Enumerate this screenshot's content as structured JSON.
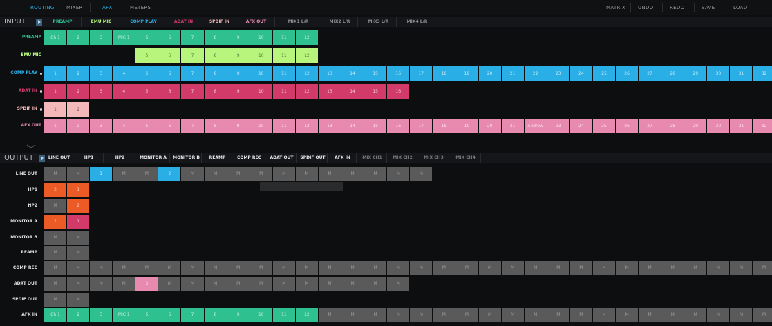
{
  "topnav": {
    "tabs": [
      {
        "label": "ROUTING",
        "active": true
      },
      {
        "label": "MIXER",
        "active": false
      },
      {
        "label": "AFX",
        "active": true
      },
      {
        "label": "METERS",
        "active": false
      }
    ],
    "actions": [
      "MATRIX",
      "UNDO",
      "REDO",
      "SAVE",
      "LOAD"
    ]
  },
  "input": {
    "label": "INPUT",
    "tabs": [
      {
        "label": "PREAMP",
        "color": "#2fc08f"
      },
      {
        "label": "EMU MIC",
        "color": "#b8f57c"
      },
      {
        "label": "COMP PLAY",
        "color": "#2aaee6"
      },
      {
        "label": "ADAT IN",
        "color": "#d23a6a"
      },
      {
        "label": "SPDIF IN",
        "color": "#f3b9ba"
      },
      {
        "label": "AFX OUT",
        "color": "#e889b0"
      },
      {
        "label": "MIX1 L/R",
        "color": "#8c8c8c"
      },
      {
        "label": "MIX2 L/R",
        "color": "#8c8c8c"
      },
      {
        "label": "MIX3 L/R",
        "color": "#8c8c8c"
      },
      {
        "label": "MIX4 L/R",
        "color": "#8c8c8c"
      }
    ],
    "rows": [
      {
        "name": "PREAMP",
        "color": "#2fc08f",
        "start": 0,
        "dot": false,
        "cells": [
          "Ch 1",
          "2",
          "3",
          "MIC 1",
          "5",
          "6",
          "7",
          "8",
          "9",
          "10",
          "11",
          "12"
        ]
      },
      {
        "name": "EMU MIC",
        "color": "#b8f57c",
        "start": 4,
        "dot": false,
        "cells": [
          "5",
          "6",
          "7",
          "8",
          "9",
          "10",
          "11",
          "12"
        ]
      },
      {
        "name": "COMP PLAY",
        "color": "#2aaee6",
        "start": 0,
        "dot": true,
        "cells": [
          "1",
          "2",
          "3",
          "4",
          "5",
          "6",
          "7",
          "8",
          "9",
          "10",
          "11",
          "12",
          "13",
          "14",
          "15",
          "16",
          "17",
          "18",
          "19",
          "20",
          "21",
          "22",
          "23",
          "24",
          "25",
          "26",
          "27",
          "28",
          "29",
          "30",
          "31",
          "32"
        ]
      },
      {
        "name": "ADAT IN",
        "color": "#d23a6a",
        "start": 0,
        "dot": true,
        "cells": [
          "1",
          "2",
          "3",
          "4",
          "5",
          "6",
          "7",
          "8",
          "9",
          "10",
          "11",
          "12",
          "13",
          "14",
          "15",
          "16"
        ]
      },
      {
        "name": "SPDIF IN",
        "color": "#f3b9ba",
        "start": 0,
        "dot": true,
        "cells": [
          "1",
          "2"
        ]
      },
      {
        "name": "AFX OUT",
        "color": "#e889b0",
        "start": 0,
        "dot": false,
        "cells": [
          "1",
          "2",
          "3",
          "4",
          "5",
          "6",
          "7",
          "8",
          "9",
          "10",
          "11",
          "12",
          "13",
          "14",
          "15",
          "16",
          "17",
          "18",
          "19",
          "20",
          "21",
          "Andrew",
          "23",
          "24",
          "25",
          "26",
          "27",
          "28",
          "29",
          "30",
          "31",
          "32"
        ]
      }
    ]
  },
  "output": {
    "label": "OUTPUT",
    "tabs": [
      {
        "label": "LINE OUT",
        "dim": false
      },
      {
        "label": "HP1",
        "dim": false
      },
      {
        "label": "HP2",
        "dim": false
      },
      {
        "label": "MONITOR A",
        "dim": false
      },
      {
        "label": "MONITOR B",
        "dim": false
      },
      {
        "label": "REAMP",
        "dim": false
      },
      {
        "label": "COMP REC",
        "dim": false
      },
      {
        "label": "ADAT OUT",
        "dim": false
      },
      {
        "label": "SPDIF OUT",
        "dim": false
      },
      {
        "label": "AFX IN",
        "dim": false
      },
      {
        "label": "MIX CH1",
        "dim": true
      },
      {
        "label": "MIX CH2",
        "dim": true
      },
      {
        "label": "MIX CH3",
        "dim": true
      },
      {
        "label": "MIX CH4",
        "dim": true
      }
    ],
    "rows": [
      {
        "name": "LINE OUT",
        "cells": [
          {
            "t": "M",
            "c": "gray"
          },
          {
            "t": "M",
            "c": "gray"
          },
          {
            "t": "1",
            "c": "blue"
          },
          {
            "t": "M",
            "c": "gray"
          },
          {
            "t": "M",
            "c": "gray"
          },
          {
            "t": "2",
            "c": "blue"
          },
          {
            "t": "M",
            "c": "gray"
          },
          {
            "t": "M",
            "c": "gray"
          },
          {
            "t": "M",
            "c": "gray"
          },
          {
            "t": "M",
            "c": "gray"
          },
          {
            "t": "M",
            "c": "gray"
          },
          {
            "t": "M",
            "c": "gray"
          },
          {
            "t": "M",
            "c": "gray"
          },
          {
            "t": "M",
            "c": "gray"
          },
          {
            "t": "M",
            "c": "gray"
          },
          {
            "t": "M",
            "c": "gray"
          },
          {
            "t": "M",
            "c": "gray"
          }
        ]
      },
      {
        "name": "HP1",
        "cells": [
          {
            "t": "2",
            "c": "orange"
          },
          {
            "t": "1",
            "c": "orange"
          }
        ]
      },
      {
        "name": "HP2",
        "cells": [
          {
            "t": "M",
            "c": "gray"
          },
          {
            "t": "2",
            "c": "orange"
          }
        ]
      },
      {
        "name": "MONITOR A",
        "cells": [
          {
            "t": "2",
            "c": "orange"
          },
          {
            "t": "1",
            "c": "magenta"
          }
        ]
      },
      {
        "name": "MONITOR B",
        "cells": [
          {
            "t": "M",
            "c": "gray"
          },
          {
            "t": "M",
            "c": "gray"
          }
        ]
      },
      {
        "name": "REAMP",
        "cells": [
          {
            "t": "M",
            "c": "gray"
          },
          {
            "t": "M",
            "c": "gray"
          }
        ]
      },
      {
        "name": "COMP REC",
        "fillGray": 32,
        "cells": []
      },
      {
        "name": "ADAT OUT",
        "cells": [
          {
            "t": "M",
            "c": "gray"
          },
          {
            "t": "M",
            "c": "gray"
          },
          {
            "t": "M",
            "c": "gray"
          },
          {
            "t": "M",
            "c": "gray"
          },
          {
            "t": "3",
            "c": "pink"
          },
          {
            "t": "M",
            "c": "gray"
          },
          {
            "t": "M",
            "c": "gray"
          },
          {
            "t": "M",
            "c": "gray"
          },
          {
            "t": "M",
            "c": "gray"
          },
          {
            "t": "M",
            "c": "gray"
          },
          {
            "t": "M",
            "c": "gray"
          },
          {
            "t": "M",
            "c": "gray"
          },
          {
            "t": "M",
            "c": "gray"
          },
          {
            "t": "M",
            "c": "gray"
          },
          {
            "t": "M",
            "c": "gray"
          },
          {
            "t": "M",
            "c": "gray"
          }
        ]
      },
      {
        "name": "SPDIF OUT",
        "cells": [
          {
            "t": "M",
            "c": "gray"
          },
          {
            "t": "M",
            "c": "gray"
          }
        ]
      },
      {
        "name": "AFX IN",
        "cells": [
          {
            "t": "Ch 1",
            "c": "green"
          },
          {
            "t": "2",
            "c": "green"
          },
          {
            "t": "3",
            "c": "green"
          },
          {
            "t": "MIC 1",
            "c": "green"
          },
          {
            "t": "5",
            "c": "green"
          },
          {
            "t": "6",
            "c": "green"
          },
          {
            "t": "7",
            "c": "green"
          },
          {
            "t": "8",
            "c": "green"
          },
          {
            "t": "9",
            "c": "green"
          },
          {
            "t": "10",
            "c": "green"
          },
          {
            "t": "11",
            "c": "green"
          },
          {
            "t": "12",
            "c": "green"
          }
        ],
        "fillGray": 20
      }
    ],
    "overlay_text": "— — — — —"
  },
  "colors": {
    "gray": "#5a5a5a",
    "blue": "#2aaee6",
    "orange": "#ec5a25",
    "magenta": "#d23a6a",
    "pink": "#e889b0",
    "green": "#2fc08f",
    "accent": "#25b4ea"
  }
}
